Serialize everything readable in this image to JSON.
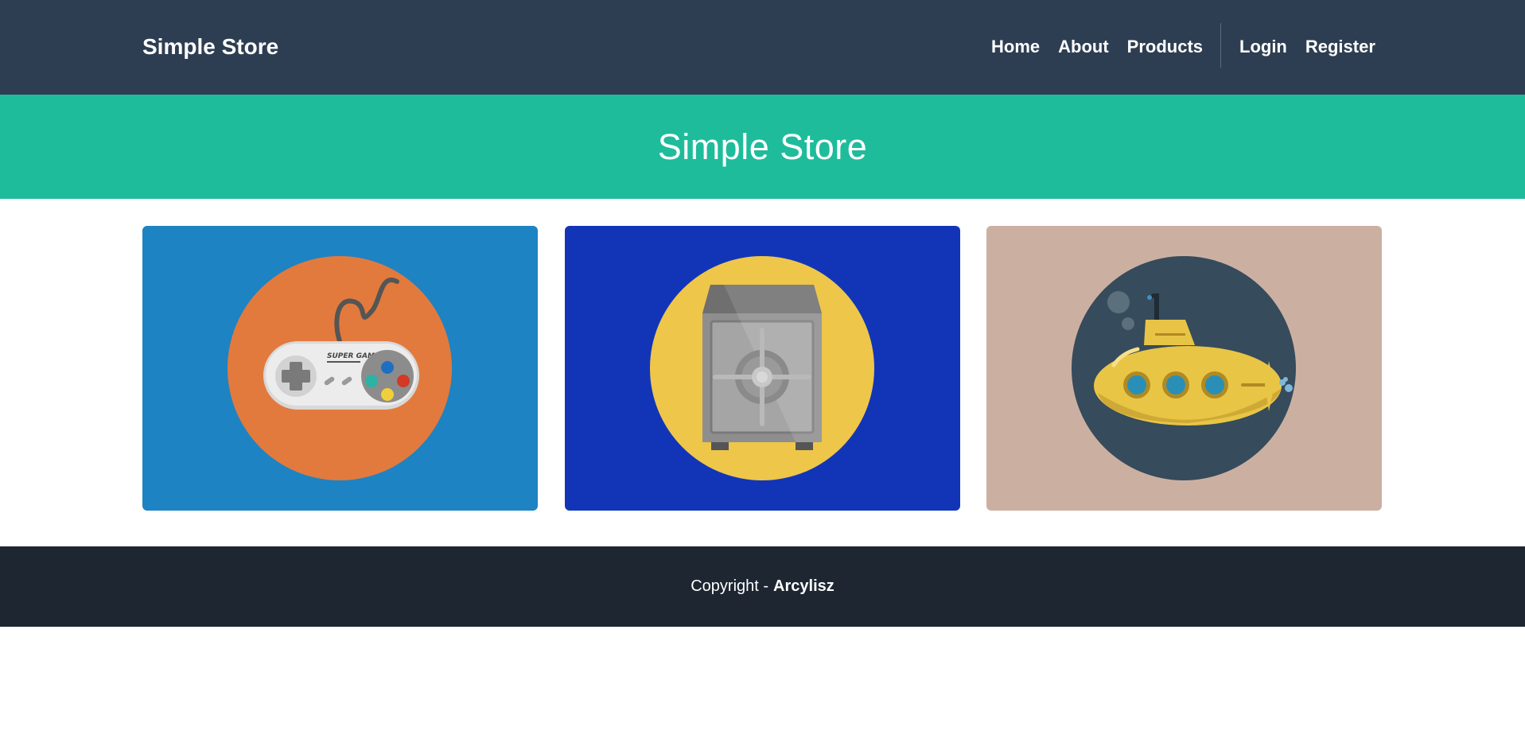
{
  "navbar": {
    "brand": "Simple Store",
    "left_links": [
      {
        "label": "Home"
      },
      {
        "label": "About"
      },
      {
        "label": "Products"
      }
    ],
    "right_links": [
      {
        "label": "Login"
      },
      {
        "label": "Register"
      }
    ]
  },
  "hero": {
    "title": "Simple Store"
  },
  "products": [
    {
      "icon": "game-controller-icon",
      "card_color": "#1e83c2",
      "circle_color": "#e27a3d",
      "controller_label": "SUPER GAME"
    },
    {
      "icon": "safe-icon",
      "card_color": "#1235b8",
      "circle_color": "#eec649"
    },
    {
      "icon": "submarine-icon",
      "card_color": "#cbb0a2",
      "circle_color": "#364b5c"
    }
  ],
  "footer": {
    "prefix": "Copyright - ",
    "author": "Arcylisz"
  },
  "colors": {
    "navbar": "#2e3e52",
    "hero": "#1ebc9b",
    "footer": "#1d2631"
  }
}
